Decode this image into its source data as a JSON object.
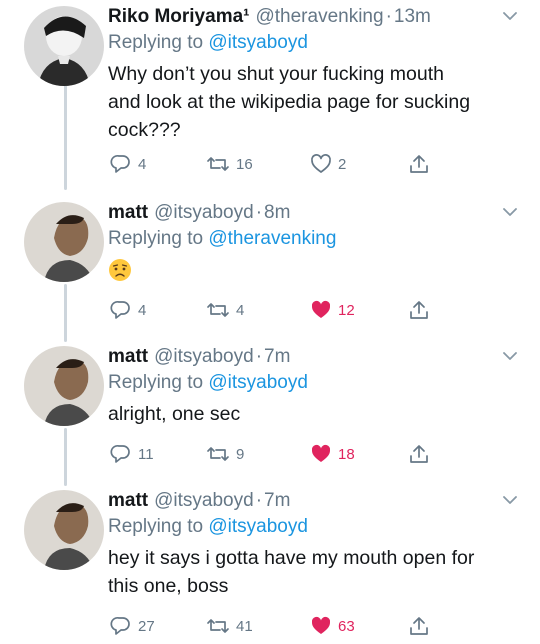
{
  "tweets": [
    {
      "name": "Riko Moriyama¹",
      "handle": "@theravenking",
      "time": "13m",
      "replying_prefix": "Replying to",
      "replying_to": "@itsyaboyd",
      "text_lines": [
        "Why don’t you shut your fucking mouth",
        "and look at the wikipedia page for sucking",
        "cock???"
      ],
      "replies": "4",
      "retweets": "16",
      "likes": "2",
      "liked": false
    },
    {
      "name": "matt",
      "handle": "@itsyaboyd",
      "time": "8m",
      "replying_prefix": "Replying to",
      "replying_to": "@theravenking",
      "emoji": "😟",
      "replies": "4",
      "retweets": "4",
      "likes": "12",
      "liked": true
    },
    {
      "name": "matt",
      "handle": "@itsyaboyd",
      "time": "7m",
      "replying_prefix": "Replying to",
      "replying_to": "@itsyaboyd",
      "text_lines": [
        "alright, one sec"
      ],
      "replies": "11",
      "retweets": "9",
      "likes": "18",
      "liked": true
    },
    {
      "name": "matt",
      "handle": "@itsyaboyd",
      "time": "7m",
      "replying_prefix": "Replying to",
      "replying_to": "@itsyaboyd",
      "text_lines": [
        "hey it says i gotta have my mouth open for",
        "this one, boss"
      ],
      "replies": "27",
      "retweets": "41",
      "likes": "63",
      "liked": true
    }
  ],
  "colors": {
    "text": "#14171a",
    "muted": "#657786",
    "link": "#1b95e0",
    "like": "#e0245e",
    "thread_line": "#cdd5dc"
  },
  "icons": {
    "reply": "reply-icon",
    "retweet": "retweet-icon",
    "like": "heart-icon",
    "share": "share-icon",
    "menu": "chevron-down-icon"
  }
}
